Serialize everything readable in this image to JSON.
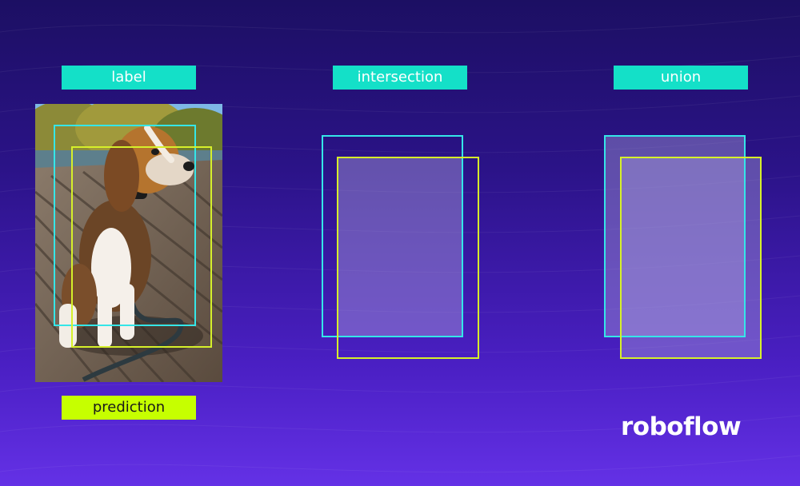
{
  "labels": {
    "label": "label",
    "prediction": "prediction",
    "intersection": "intersection",
    "union": "union"
  },
  "brand": {
    "logo_text": "roboflow"
  },
  "colors": {
    "label_box": "#35e6e8",
    "prediction_box": "#d6f02a",
    "label_tag": "#14e0c8",
    "prediction_tag": "#c6ff00",
    "background_top": "#1c0f63",
    "background_bottom": "#6431e6"
  },
  "photo": {
    "subject": "beagle-dog-on-wooden-deck"
  }
}
